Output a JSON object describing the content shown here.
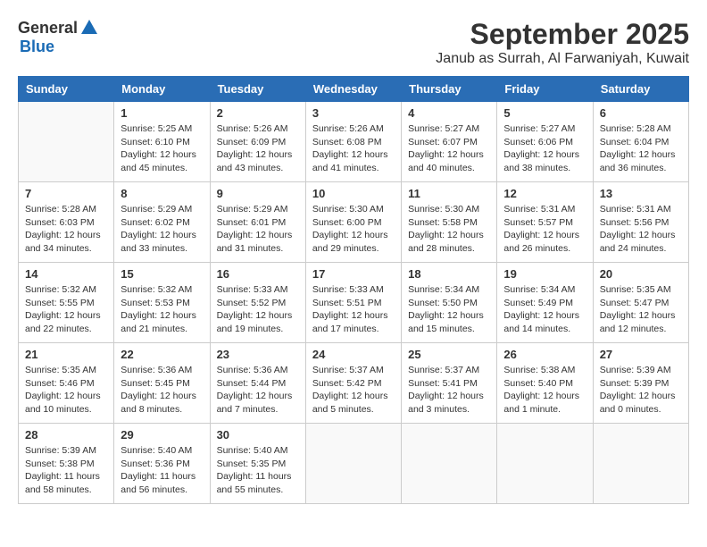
{
  "logo": {
    "general": "General",
    "blue": "Blue"
  },
  "title": "September 2025",
  "subtitle": "Janub as Surrah, Al Farwaniyah, Kuwait",
  "headers": [
    "Sunday",
    "Monday",
    "Tuesday",
    "Wednesday",
    "Thursday",
    "Friday",
    "Saturday"
  ],
  "weeks": [
    [
      {
        "day": "",
        "info": ""
      },
      {
        "day": "1",
        "info": "Sunrise: 5:25 AM\nSunset: 6:10 PM\nDaylight: 12 hours\nand 45 minutes."
      },
      {
        "day": "2",
        "info": "Sunrise: 5:26 AM\nSunset: 6:09 PM\nDaylight: 12 hours\nand 43 minutes."
      },
      {
        "day": "3",
        "info": "Sunrise: 5:26 AM\nSunset: 6:08 PM\nDaylight: 12 hours\nand 41 minutes."
      },
      {
        "day": "4",
        "info": "Sunrise: 5:27 AM\nSunset: 6:07 PM\nDaylight: 12 hours\nand 40 minutes."
      },
      {
        "day": "5",
        "info": "Sunrise: 5:27 AM\nSunset: 6:06 PM\nDaylight: 12 hours\nand 38 minutes."
      },
      {
        "day": "6",
        "info": "Sunrise: 5:28 AM\nSunset: 6:04 PM\nDaylight: 12 hours\nand 36 minutes."
      }
    ],
    [
      {
        "day": "7",
        "info": "Sunrise: 5:28 AM\nSunset: 6:03 PM\nDaylight: 12 hours\nand 34 minutes."
      },
      {
        "day": "8",
        "info": "Sunrise: 5:29 AM\nSunset: 6:02 PM\nDaylight: 12 hours\nand 33 minutes."
      },
      {
        "day": "9",
        "info": "Sunrise: 5:29 AM\nSunset: 6:01 PM\nDaylight: 12 hours\nand 31 minutes."
      },
      {
        "day": "10",
        "info": "Sunrise: 5:30 AM\nSunset: 6:00 PM\nDaylight: 12 hours\nand 29 minutes."
      },
      {
        "day": "11",
        "info": "Sunrise: 5:30 AM\nSunset: 5:58 PM\nDaylight: 12 hours\nand 28 minutes."
      },
      {
        "day": "12",
        "info": "Sunrise: 5:31 AM\nSunset: 5:57 PM\nDaylight: 12 hours\nand 26 minutes."
      },
      {
        "day": "13",
        "info": "Sunrise: 5:31 AM\nSunset: 5:56 PM\nDaylight: 12 hours\nand 24 minutes."
      }
    ],
    [
      {
        "day": "14",
        "info": "Sunrise: 5:32 AM\nSunset: 5:55 PM\nDaylight: 12 hours\nand 22 minutes."
      },
      {
        "day": "15",
        "info": "Sunrise: 5:32 AM\nSunset: 5:53 PM\nDaylight: 12 hours\nand 21 minutes."
      },
      {
        "day": "16",
        "info": "Sunrise: 5:33 AM\nSunset: 5:52 PM\nDaylight: 12 hours\nand 19 minutes."
      },
      {
        "day": "17",
        "info": "Sunrise: 5:33 AM\nSunset: 5:51 PM\nDaylight: 12 hours\nand 17 minutes."
      },
      {
        "day": "18",
        "info": "Sunrise: 5:34 AM\nSunset: 5:50 PM\nDaylight: 12 hours\nand 15 minutes."
      },
      {
        "day": "19",
        "info": "Sunrise: 5:34 AM\nSunset: 5:49 PM\nDaylight: 12 hours\nand 14 minutes."
      },
      {
        "day": "20",
        "info": "Sunrise: 5:35 AM\nSunset: 5:47 PM\nDaylight: 12 hours\nand 12 minutes."
      }
    ],
    [
      {
        "day": "21",
        "info": "Sunrise: 5:35 AM\nSunset: 5:46 PM\nDaylight: 12 hours\nand 10 minutes."
      },
      {
        "day": "22",
        "info": "Sunrise: 5:36 AM\nSunset: 5:45 PM\nDaylight: 12 hours\nand 8 minutes."
      },
      {
        "day": "23",
        "info": "Sunrise: 5:36 AM\nSunset: 5:44 PM\nDaylight: 12 hours\nand 7 minutes."
      },
      {
        "day": "24",
        "info": "Sunrise: 5:37 AM\nSunset: 5:42 PM\nDaylight: 12 hours\nand 5 minutes."
      },
      {
        "day": "25",
        "info": "Sunrise: 5:37 AM\nSunset: 5:41 PM\nDaylight: 12 hours\nand 3 minutes."
      },
      {
        "day": "26",
        "info": "Sunrise: 5:38 AM\nSunset: 5:40 PM\nDaylight: 12 hours\nand 1 minute."
      },
      {
        "day": "27",
        "info": "Sunrise: 5:39 AM\nSunset: 5:39 PM\nDaylight: 12 hours\nand 0 minutes."
      }
    ],
    [
      {
        "day": "28",
        "info": "Sunrise: 5:39 AM\nSunset: 5:38 PM\nDaylight: 11 hours\nand 58 minutes."
      },
      {
        "day": "29",
        "info": "Sunrise: 5:40 AM\nSunset: 5:36 PM\nDaylight: 11 hours\nand 56 minutes."
      },
      {
        "day": "30",
        "info": "Sunrise: 5:40 AM\nSunset: 5:35 PM\nDaylight: 11 hours\nand 55 minutes."
      },
      {
        "day": "",
        "info": ""
      },
      {
        "day": "",
        "info": ""
      },
      {
        "day": "",
        "info": ""
      },
      {
        "day": "",
        "info": ""
      }
    ]
  ]
}
